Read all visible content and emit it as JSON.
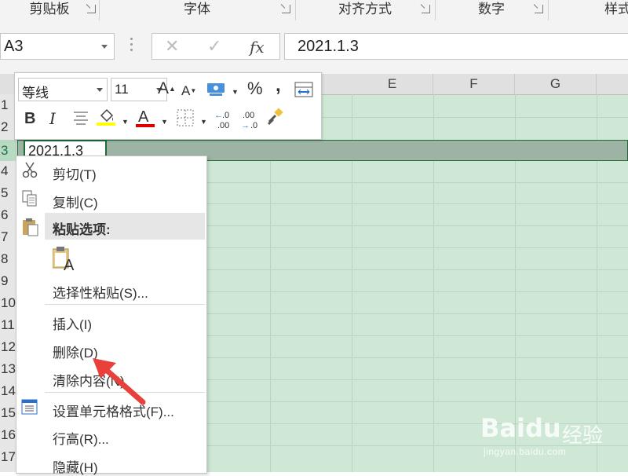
{
  "ribbon": {
    "groups": [
      "剪贴板",
      "字体",
      "对齐方式",
      "数字",
      "样式"
    ]
  },
  "formula_bar": {
    "name_box": "A3",
    "cancel_icon": "✕",
    "enter_icon": "✓",
    "fx_label": "fx",
    "formula": "2021.1.3"
  },
  "sheet": {
    "columns": [
      "E",
      "F",
      "G"
    ],
    "rows": [
      "1",
      "2",
      "3",
      "4",
      "5",
      "6",
      "7",
      "8",
      "9",
      "10",
      "11",
      "12",
      "13",
      "14",
      "15",
      "16",
      "17"
    ],
    "active_cell_value": "2021.1.3",
    "colors": {
      "selection": "#cfe8d6",
      "selected_row": "#9db3a4",
      "accent": "#217346"
    }
  },
  "mini_toolbar": {
    "font_name": "等线",
    "font_size": "11",
    "grow_font": "A",
    "shrink_font": "A",
    "percent": "%",
    "comma": ",",
    "bold": "B",
    "italic": "I",
    "font_color_letter": "A",
    "inc_decimal": ".00",
    "dec_decimal": ".0",
    "colors": {
      "fill_underline": "#ffff00",
      "font_underline": "#e00000"
    }
  },
  "context_menu": {
    "cut": "剪切(T)",
    "copy": "复制(C)",
    "paste_options": "粘贴选项:",
    "paste_special": "选择性粘贴(S)...",
    "insert": "插入(I)",
    "delete": "删除(D)",
    "clear": "清除内容(N)",
    "format_cells": "设置单元格格式(F)...",
    "row_height": "行高(R)...",
    "hide": "隐藏(H)"
  },
  "watermark": {
    "brand": "Baidu",
    "jingyan": "经验",
    "url": "jingyan.baidu.com"
  }
}
